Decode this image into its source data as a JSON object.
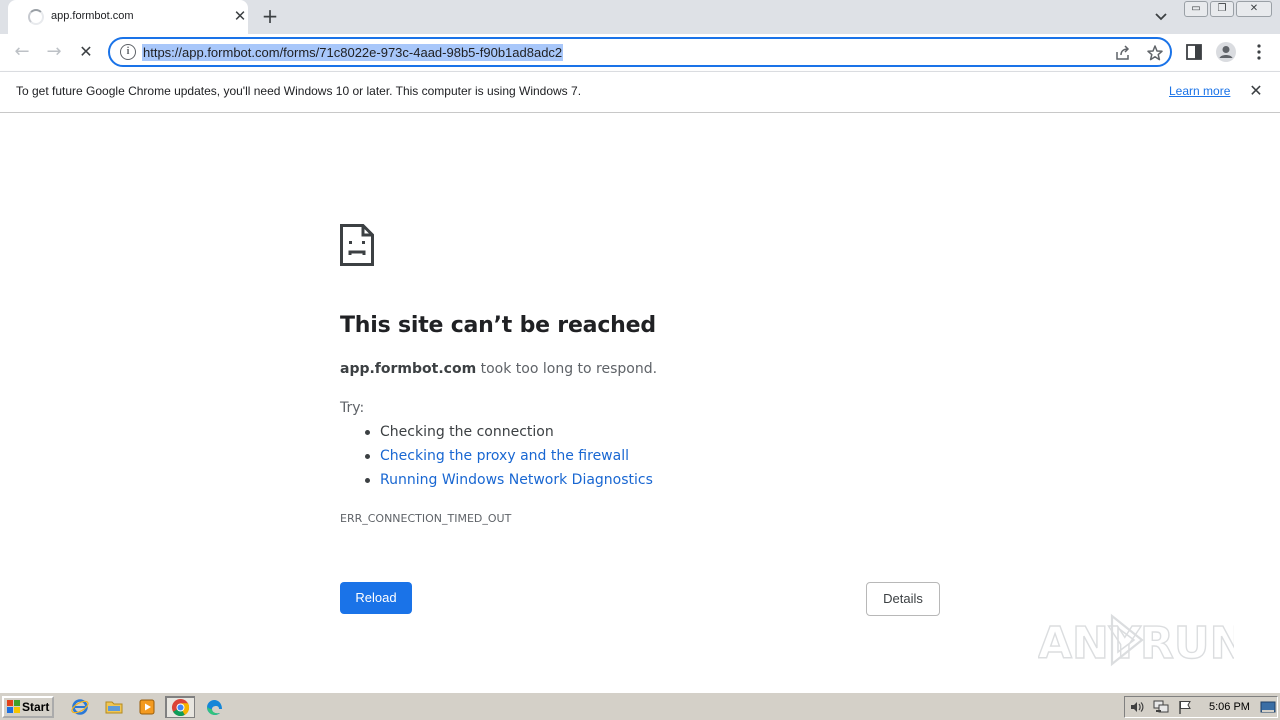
{
  "browser": {
    "tab": {
      "title": "app.formbot.com",
      "close_glyph": "✕",
      "new_tab_glyph": "+"
    },
    "window_controls": {
      "minimize": "▭",
      "restore": "❐",
      "close": "✕"
    },
    "toolbar": {
      "back_glyph": "←",
      "forward_glyph": "→",
      "stop_glyph": "✕",
      "info_glyph": "i",
      "url": "https://app.formbot.com/forms/71c8022e-973c-4aad-98b5-f90b1ad8adc2"
    },
    "infobar": {
      "message": "To get future Google Chrome updates, you'll need Windows 10 or later. This computer is using Windows 7.",
      "link": "Learn more",
      "close_glyph": "✕"
    }
  },
  "error_page": {
    "title": "This site can’t be reached",
    "host": "app.formbot.com",
    "description_suffix": " took too long to respond.",
    "try_label": "Try:",
    "suggestions": [
      {
        "text": "Checking the connection",
        "is_link": false
      },
      {
        "text": "Checking the proxy and the firewall",
        "is_link": true
      },
      {
        "text": "Running Windows Network Diagnostics",
        "is_link": true
      }
    ],
    "error_code": "ERR_CONNECTION_TIMED_OUT",
    "reload_label": "Reload",
    "details_label": "Details"
  },
  "watermark": {
    "left": "ANY",
    "right": "RUN"
  },
  "taskbar": {
    "start_label": "Start",
    "apps": [
      "internet-explorer-icon",
      "file-explorer-icon",
      "media-player-icon",
      "chrome-icon",
      "edge-icon"
    ],
    "clock": "5:06 PM"
  },
  "colors": {
    "accent": "#1a73e8",
    "link": "#1967d2",
    "tabstrip": "#dee1e6",
    "taskbar": "#d4d0c8"
  }
}
